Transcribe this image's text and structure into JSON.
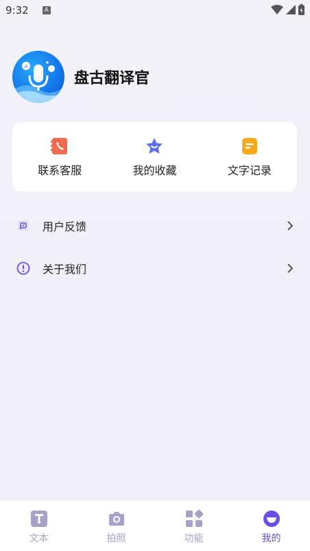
{
  "status": {
    "time": "9:32",
    "notif_letter": "A"
  },
  "profile": {
    "app_name": "盘古翻译官"
  },
  "shortcuts": [
    {
      "label": "联系客服",
      "icon": "contact-book-icon",
      "color": "#f06a4f"
    },
    {
      "label": "我的收藏",
      "icon": "star-smile-icon",
      "color": "#5d6ff0"
    },
    {
      "label": "文字记录",
      "icon": "note-icon",
      "color": "#f7a81b"
    }
  ],
  "menu": [
    {
      "label": "用户反馈",
      "icon": "feedback-icon"
    },
    {
      "label": "关于我们",
      "icon": "info-icon"
    }
  ],
  "tabs": [
    {
      "label": "文本",
      "icon": "text-icon",
      "active": false
    },
    {
      "label": "拍照",
      "icon": "camera-icon",
      "active": false
    },
    {
      "label": "功能",
      "icon": "apps-icon",
      "active": false
    },
    {
      "label": "我的",
      "icon": "profile-smile-icon",
      "active": true
    }
  ],
  "colors": {
    "accent": "#6b4fe0",
    "tab_inactive": "#a7a3c8",
    "background": "#f2f1f9"
  }
}
